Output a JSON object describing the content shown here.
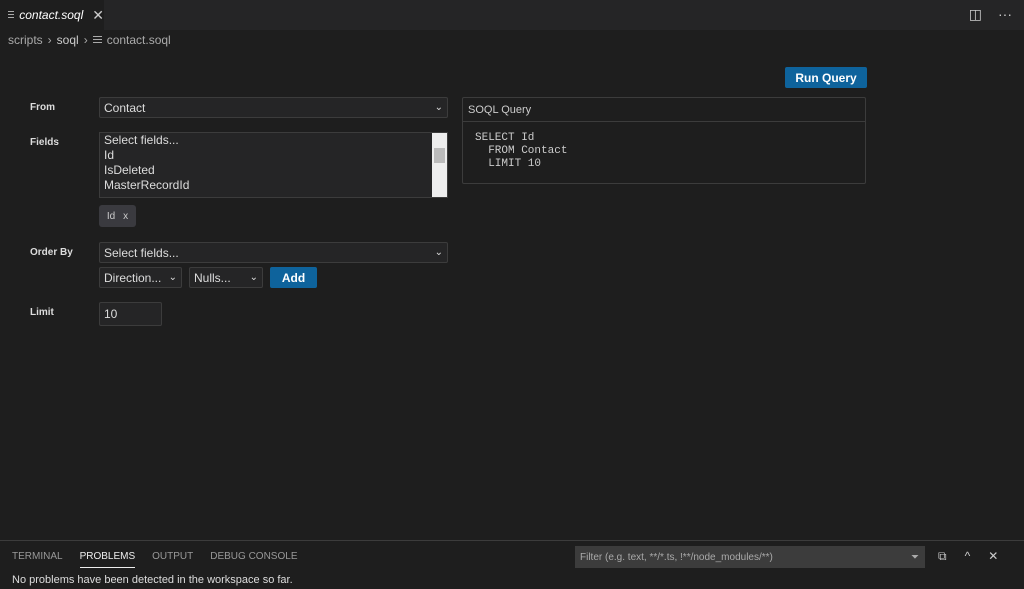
{
  "tab": {
    "title": "contact.soql",
    "close": "✕"
  },
  "tab_actions": {
    "split": "◫",
    "more": "···"
  },
  "breadcrumb": [
    "scripts",
    "soql",
    "contact.soql"
  ],
  "form": {
    "from_label": "From",
    "from_value": "Contact",
    "fields_label": "Fields",
    "fields_options": [
      "Select fields...",
      "Id",
      "IsDeleted",
      "MasterRecordId"
    ],
    "selected_field": "Id",
    "selected_remove": "x",
    "orderby_label": "Order By",
    "orderby_placeholder": "Select fields...",
    "direction": "Direction...",
    "nulls": "Nulls...",
    "add": "Add",
    "limit_label": "Limit",
    "limit_value": "10"
  },
  "run_query": "Run Query",
  "query": {
    "title": "SOQL Query",
    "text": "SELECT Id\n  FROM Contact\n  LIMIT 10"
  },
  "panel": {
    "tabs": [
      "TERMINAL",
      "PROBLEMS",
      "OUTPUT",
      "DEBUG CONSOLE"
    ],
    "active_tab": "PROBLEMS",
    "filter_placeholder": "Filter (e.g. text, **/*.ts, !**/node_modules/**)",
    "message": "No problems have been detected in the workspace so far."
  },
  "colors": {
    "accent": "#0e639c",
    "background": "#1e1e1e"
  }
}
